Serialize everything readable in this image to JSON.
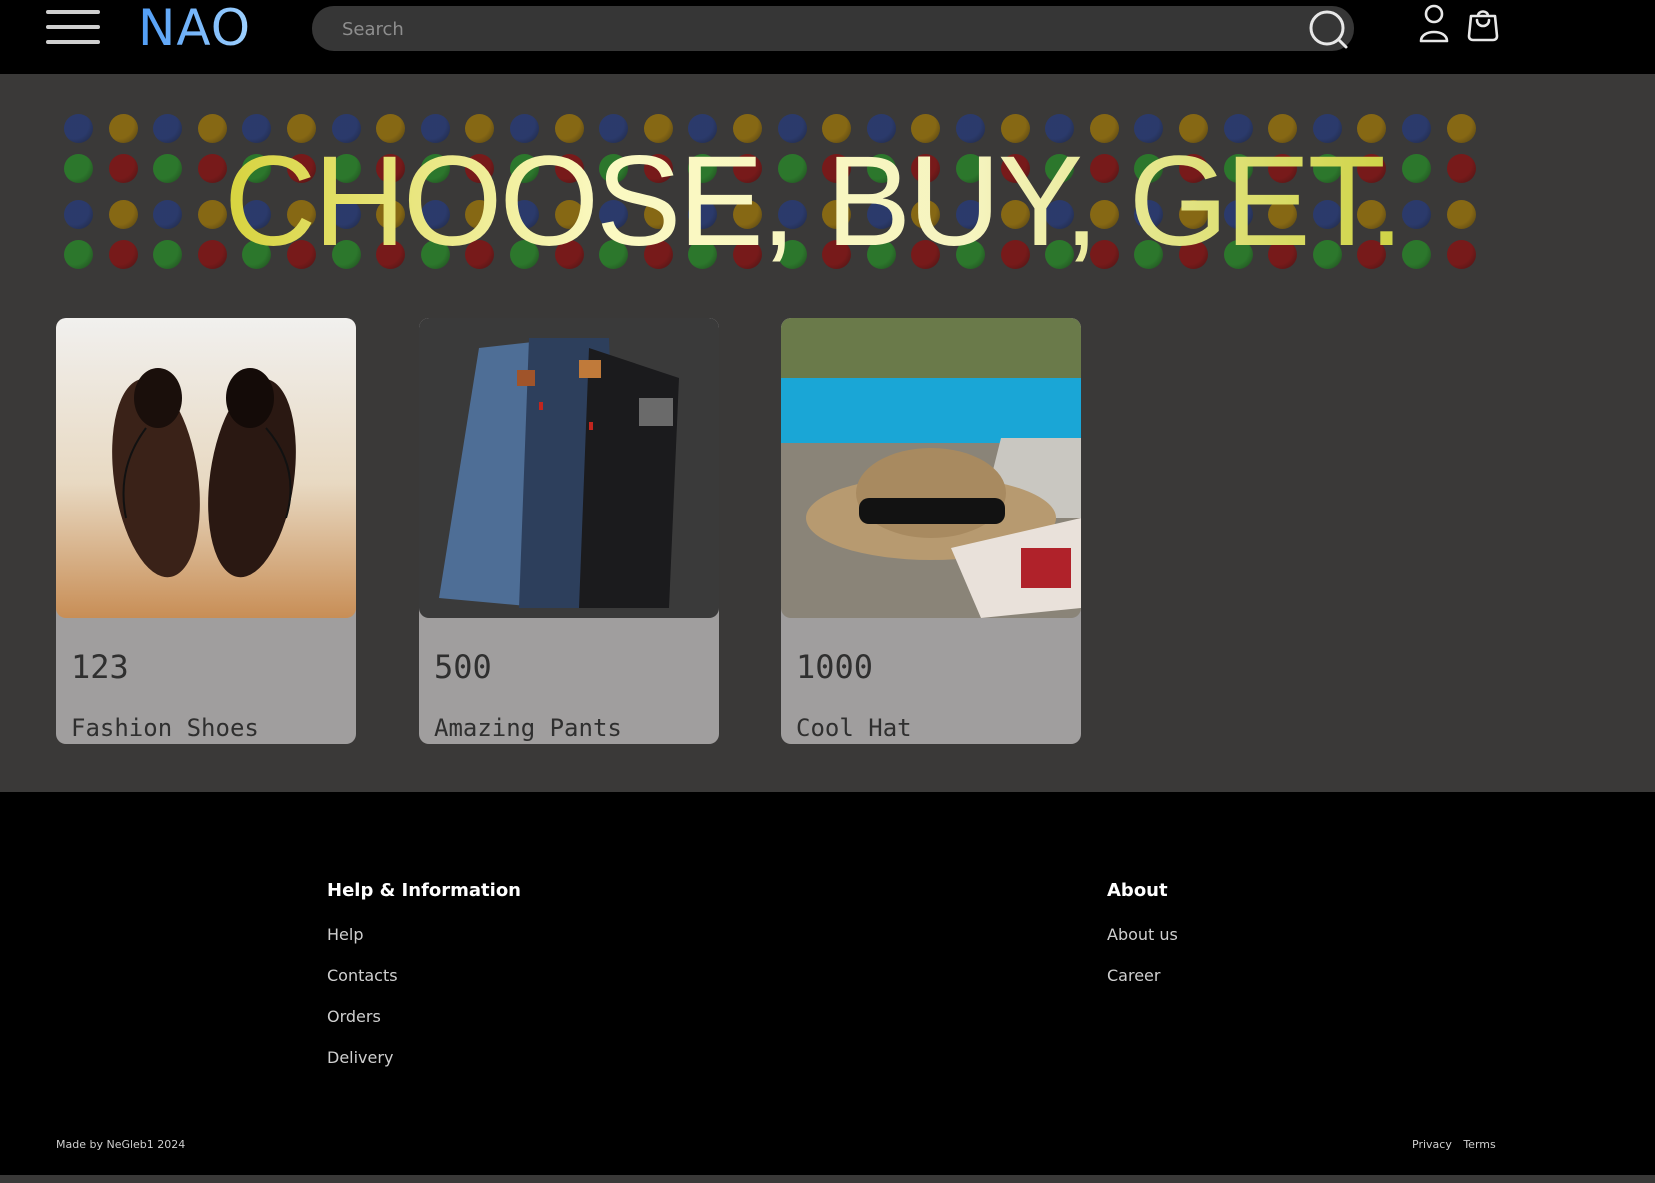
{
  "header": {
    "logo": "NAO",
    "search_placeholder": "Search"
  },
  "hero": {
    "title": "CHOOSE, BUY, GET.",
    "dot_colors": [
      "#2a3a6e",
      "#8a6a12",
      "#2b7a2b",
      "#7a1818"
    ]
  },
  "products": [
    {
      "price": "123",
      "name": "Fashion Shoes"
    },
    {
      "price": "500",
      "name": "Amazing Pants"
    },
    {
      "price": "1000",
      "name": "Cool Hat"
    }
  ],
  "footer": {
    "help_heading": "Help & Information",
    "help_links": [
      "Help",
      "Contacts",
      "Orders",
      "Delivery"
    ],
    "about_heading": "About",
    "about_links": [
      "About us",
      "Career"
    ],
    "credit": "Made by NeGleb1 2024",
    "legal_links": [
      "Privacy",
      "Terms"
    ]
  },
  "colors": {
    "header_bg": "#000000",
    "page_bg": "#3a3938",
    "card_bg": "#a09e9e",
    "logo_gradient": [
      "#4f9cf5",
      "#9fd1ff"
    ],
    "hero_gradient": [
      "#d7d33e",
      "#fbf9c2",
      "#ccd13e"
    ]
  }
}
